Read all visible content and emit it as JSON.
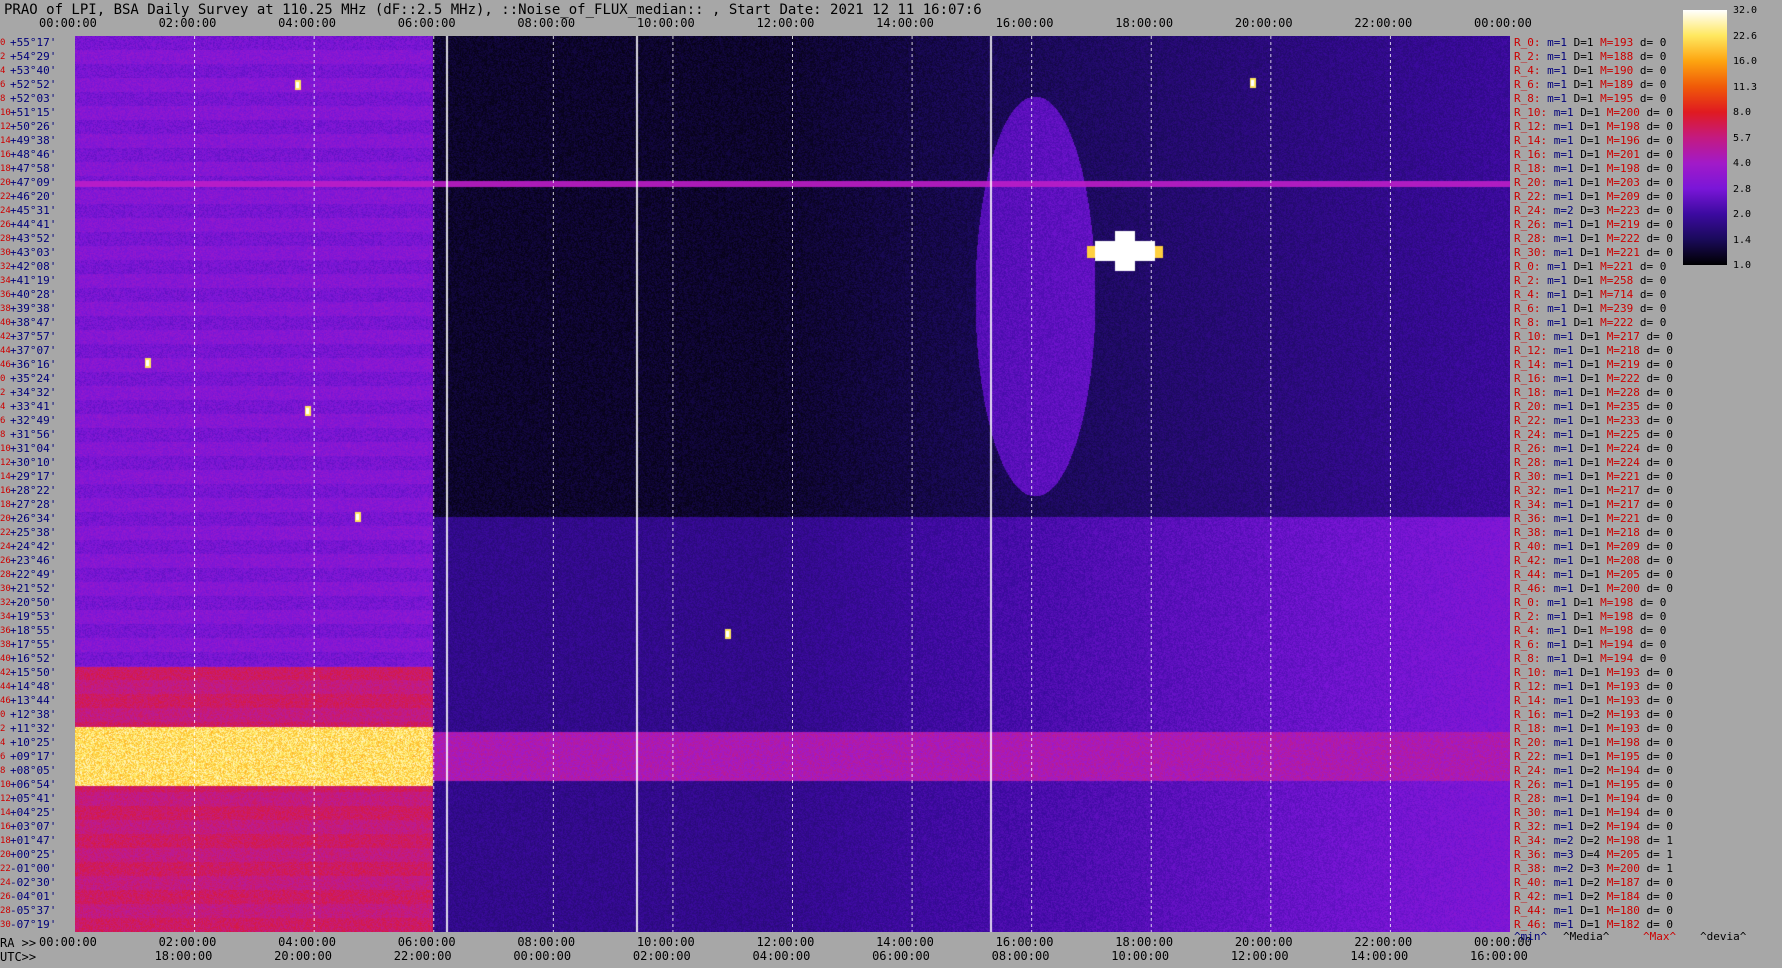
{
  "title": "PRAO of LPI, BSA Daily Survey at 110.25 MHz (dF::2.5 MHz), ::Noise_of_FLUX_median:: , Start Date: 2021 12 11 16:07:6",
  "axis_labels": {
    "ra_prefix": "RA >>",
    "utc_prefix": "UTC>>"
  },
  "colors": {
    "background": "#a7a7a7",
    "plot_bg": "#050005",
    "stat_red": "#cc0000",
    "stat_blue": "#00007a"
  },
  "legend": {
    "min": "^min^",
    "media": "^Media^",
    "max": "^Max^",
    "devia": "^devia^"
  },
  "colorbar": {
    "ticks": [
      "32.0",
      "22.6",
      "16.0",
      "11.3",
      "8.0",
      "5.7",
      "4.0",
      "2.8",
      "2.0",
      "1.4",
      "1.0"
    ]
  },
  "chart_data": {
    "type": "heatmap",
    "x_top_ticks": [
      "00:00:00",
      "02:00:00",
      "04:00:00",
      "06:00:00",
      "08:00:00",
      "10:00:00",
      "12:00:00",
      "14:00:00",
      "16:00:00",
      "18:00:00",
      "20:00:00",
      "22:00:00",
      "00:00:00"
    ],
    "x_ra_ticks": [
      "00:00:00",
      "02:00:00",
      "04:00:00",
      "06:00:00",
      "08:00:00",
      "10:00:00",
      "12:00:00",
      "14:00:00",
      "16:00:00",
      "18:00:00",
      "20:00:00",
      "22:00:00",
      "00:00:00"
    ],
    "x_utc_ticks": [
      "18:00:00",
      "20:00:00",
      "22:00:00",
      "00:00:00",
      "02:00:00",
      "04:00:00",
      "06:00:00",
      "08:00:00",
      "10:00:00",
      "12:00:00",
      "14:00:00",
      "16:00:00"
    ],
    "declinations": [
      "+55°17'",
      "+54°29'",
      "+53°40'",
      "+52°52'",
      "+52°03'",
      "+51°15'",
      "+50°26'",
      "+49°38'",
      "+48°46'",
      "+47°58'",
      "+47°09'",
      "+46°20'",
      "+45°31'",
      "+44°41'",
      "+43°52'",
      "+43°03'",
      "+42°08'",
      "+41°19'",
      "+40°28'",
      "+39°38'",
      "+38°47'",
      "+37°57'",
      "+37°07'",
      "+36°16'",
      "+35°24'",
      "+34°32'",
      "+33°41'",
      "+32°49'",
      "+31°56'",
      "+31°04'",
      "+30°10'",
      "+29°17'",
      "+28°22'",
      "+27°28'",
      "+26°34'",
      "+25°38'",
      "+24°42'",
      "+23°46'",
      "+22°49'",
      "+21°52'",
      "+20°50'",
      "+19°53'",
      "+18°55'",
      "+17°55'",
      "+16°52'",
      "+15°50'",
      "+14°48'",
      "+13°44'",
      "+12°38'",
      "+11°32'",
      "+10°25'",
      "+09°17'",
      "+08°05'",
      "+06°54'",
      "+05°41'",
      "+04°25'",
      "+03°07'",
      "+01°47'",
      "+00°25'",
      "-01°00'",
      "-02°30'",
      "-04°01'",
      "-05°37'",
      "-07°19'"
    ],
    "row_index": [
      "0",
      "2",
      "4",
      "6",
      "8",
      "10",
      "12",
      "14",
      "16",
      "18",
      "20",
      "22",
      "24",
      "26",
      "28",
      "30",
      "32",
      "34",
      "36",
      "38",
      "40",
      "42",
      "44",
      "46",
      "0",
      "2",
      "4",
      "6",
      "8",
      "10",
      "12",
      "14",
      "16",
      "18",
      "20",
      "22",
      "24",
      "26",
      "28",
      "30",
      "32",
      "34",
      "36",
      "38",
      "40",
      "42",
      "44",
      "46",
      "0",
      "2",
      "4",
      "6",
      "8",
      "10",
      "12",
      "14",
      "16",
      "18",
      "20",
      "22",
      "24",
      "26",
      "28",
      "30"
    ],
    "color_scale": {
      "min": 1.0,
      "max": 32.0,
      "log": true
    },
    "stats": [
      {
        "r": "R_0:",
        "m": "1",
        "D": "1",
        "M": "193",
        "d": "0"
      },
      {
        "r": "R_2:",
        "m": "1",
        "D": "1",
        "M": "188",
        "d": "0"
      },
      {
        "r": "R_4:",
        "m": "1",
        "D": "1",
        "M": "190",
        "d": "0"
      },
      {
        "r": "R_6:",
        "m": "1",
        "D": "1",
        "M": "189",
        "d": "0"
      },
      {
        "r": "R_8:",
        "m": "1",
        "D": "1",
        "M": "195",
        "d": "0"
      },
      {
        "r": "R_10:",
        "m": "1",
        "D": "1",
        "M": "200",
        "d": "0"
      },
      {
        "r": "R_12:",
        "m": "1",
        "D": "1",
        "M": "198",
        "d": "0"
      },
      {
        "r": "R_14:",
        "m": "1",
        "D": "1",
        "M": "196",
        "d": "0"
      },
      {
        "r": "R_16:",
        "m": "1",
        "D": "1",
        "M": "201",
        "d": "0"
      },
      {
        "r": "R_18:",
        "m": "1",
        "D": "1",
        "M": "198",
        "d": "0"
      },
      {
        "r": "R_20:",
        "m": "1",
        "D": "1",
        "M": "203",
        "d": "0"
      },
      {
        "r": "R_22:",
        "m": "1",
        "D": "1",
        "M": "209",
        "d": "0"
      },
      {
        "r": "R_24:",
        "m": "2",
        "D": "3",
        "M": "223",
        "d": "0"
      },
      {
        "r": "R_26:",
        "m": "1",
        "D": "1",
        "M": "219",
        "d": "0"
      },
      {
        "r": "R_28:",
        "m": "1",
        "D": "1",
        "M": "222",
        "d": "0"
      },
      {
        "r": "R_30:",
        "m": "1",
        "D": "1",
        "M": "221",
        "d": "0"
      },
      {
        "r": "R_0:",
        "m": "1",
        "D": "1",
        "M": "221",
        "d": "0"
      },
      {
        "r": "R_2:",
        "m": "1",
        "D": "1",
        "M": "258",
        "d": "0"
      },
      {
        "r": "R_4:",
        "m": "1",
        "D": "1",
        "M": "714",
        "d": "0"
      },
      {
        "r": "R_6:",
        "m": "1",
        "D": "1",
        "M": "239",
        "d": "0"
      },
      {
        "r": "R_8:",
        "m": "1",
        "D": "1",
        "M": "222",
        "d": "0"
      },
      {
        "r": "R_10:",
        "m": "1",
        "D": "1",
        "M": "217",
        "d": "0"
      },
      {
        "r": "R_12:",
        "m": "1",
        "D": "1",
        "M": "218",
        "d": "0"
      },
      {
        "r": "R_14:",
        "m": "1",
        "D": "1",
        "M": "219",
        "d": "0"
      },
      {
        "r": "R_16:",
        "m": "1",
        "D": "1",
        "M": "222",
        "d": "0"
      },
      {
        "r": "R_18:",
        "m": "1",
        "D": "1",
        "M": "228",
        "d": "0"
      },
      {
        "r": "R_20:",
        "m": "1",
        "D": "1",
        "M": "235",
        "d": "0"
      },
      {
        "r": "R_22:",
        "m": "1",
        "D": "1",
        "M": "233",
        "d": "0"
      },
      {
        "r": "R_24:",
        "m": "1",
        "D": "1",
        "M": "225",
        "d": "0"
      },
      {
        "r": "R_26:",
        "m": "1",
        "D": "1",
        "M": "224",
        "d": "0"
      },
      {
        "r": "R_28:",
        "m": "1",
        "D": "1",
        "M": "224",
        "d": "0"
      },
      {
        "r": "R_30:",
        "m": "1",
        "D": "1",
        "M": "221",
        "d": "0"
      },
      {
        "r": "R_32:",
        "m": "1",
        "D": "1",
        "M": "217",
        "d": "0"
      },
      {
        "r": "R_34:",
        "m": "1",
        "D": "1",
        "M": "217",
        "d": "0"
      },
      {
        "r": "R_36:",
        "m": "1",
        "D": "1",
        "M": "221",
        "d": "0"
      },
      {
        "r": "R_38:",
        "m": "1",
        "D": "1",
        "M": "218",
        "d": "0"
      },
      {
        "r": "R_40:",
        "m": "1",
        "D": "1",
        "M": "209",
        "d": "0"
      },
      {
        "r": "R_42:",
        "m": "1",
        "D": "1",
        "M": "208",
        "d": "0"
      },
      {
        "r": "R_44:",
        "m": "1",
        "D": "1",
        "M": "205",
        "d": "0"
      },
      {
        "r": "R_46:",
        "m": "1",
        "D": "1",
        "M": "200",
        "d": "0"
      },
      {
        "r": "R_0:",
        "m": "1",
        "D": "1",
        "M": "198",
        "d": "0"
      },
      {
        "r": "R_2:",
        "m": "1",
        "D": "1",
        "M": "198",
        "d": "0"
      },
      {
        "r": "R_4:",
        "m": "1",
        "D": "1",
        "M": "198",
        "d": "0"
      },
      {
        "r": "R_6:",
        "m": "1",
        "D": "1",
        "M": "194",
        "d": "0"
      },
      {
        "r": "R_8:",
        "m": "1",
        "D": "1",
        "M": "194",
        "d": "0"
      },
      {
        "r": "R_10:",
        "m": "1",
        "D": "1",
        "M": "193",
        "d": "0"
      },
      {
        "r": "R_12:",
        "m": "1",
        "D": "1",
        "M": "193",
        "d": "0"
      },
      {
        "r": "R_14:",
        "m": "1",
        "D": "1",
        "M": "193",
        "d": "0"
      },
      {
        "r": "R_16:",
        "m": "1",
        "D": "2",
        "M": "193",
        "d": "0"
      },
      {
        "r": "R_18:",
        "m": "1",
        "D": "1",
        "M": "193",
        "d": "0"
      },
      {
        "r": "R_20:",
        "m": "1",
        "D": "1",
        "M": "198",
        "d": "0"
      },
      {
        "r": "R_22:",
        "m": "1",
        "D": "1",
        "M": "195",
        "d": "0"
      },
      {
        "r": "R_24:",
        "m": "1",
        "D": "2",
        "M": "194",
        "d": "0"
      },
      {
        "r": "R_26:",
        "m": "1",
        "D": "1",
        "M": "195",
        "d": "0"
      },
      {
        "r": "R_28:",
        "m": "1",
        "D": "1",
        "M": "194",
        "d": "0"
      },
      {
        "r": "R_30:",
        "m": "1",
        "D": "1",
        "M": "194",
        "d": "0"
      },
      {
        "r": "R_32:",
        "m": "1",
        "D": "2",
        "M": "194",
        "d": "0"
      },
      {
        "r": "R_34:",
        "m": "2",
        "D": "2",
        "M": "198",
        "d": "1"
      },
      {
        "r": "R_36:",
        "m": "3",
        "D": "4",
        "M": "205",
        "d": "1"
      },
      {
        "r": "R_38:",
        "m": "2",
        "D": "3",
        "M": "200",
        "d": "1"
      },
      {
        "r": "R_40:",
        "m": "1",
        "D": "2",
        "M": "187",
        "d": "0"
      },
      {
        "r": "R_42:",
        "m": "1",
        "D": "2",
        "M": "184",
        "d": "0"
      },
      {
        "r": "R_44:",
        "m": "1",
        "D": "1",
        "M": "180",
        "d": "0"
      },
      {
        "r": "R_46:",
        "m": "1",
        "D": "1",
        "M": "182",
        "d": "0"
      }
    ]
  }
}
